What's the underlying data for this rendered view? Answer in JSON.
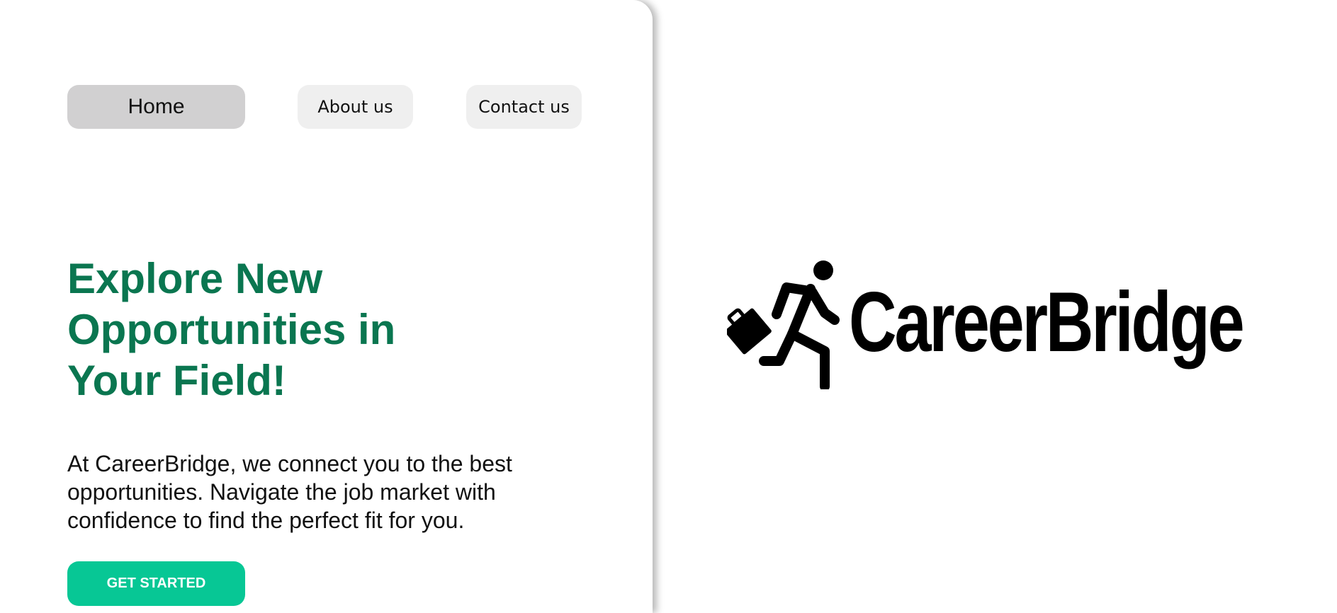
{
  "nav": {
    "items": [
      {
        "label": "Home",
        "active": true
      },
      {
        "label": "About us",
        "active": false
      },
      {
        "label": "Contact us",
        "active": false
      }
    ]
  },
  "hero": {
    "title": "Explore New Opportunities in Your Field!",
    "description": "At CareerBridge, we connect you to the best opportunities. Navigate the job market with confidence to find the perfect fit for you.",
    "cta_label": "GET STARTED"
  },
  "logo": {
    "text": "CareerBridge",
    "icon": "running-person-with-briefcase-icon"
  },
  "colors": {
    "title": "#0a7650",
    "cta_background": "#07c795",
    "nav_active": "#d1d0d1",
    "nav_inactive": "#efefef"
  }
}
